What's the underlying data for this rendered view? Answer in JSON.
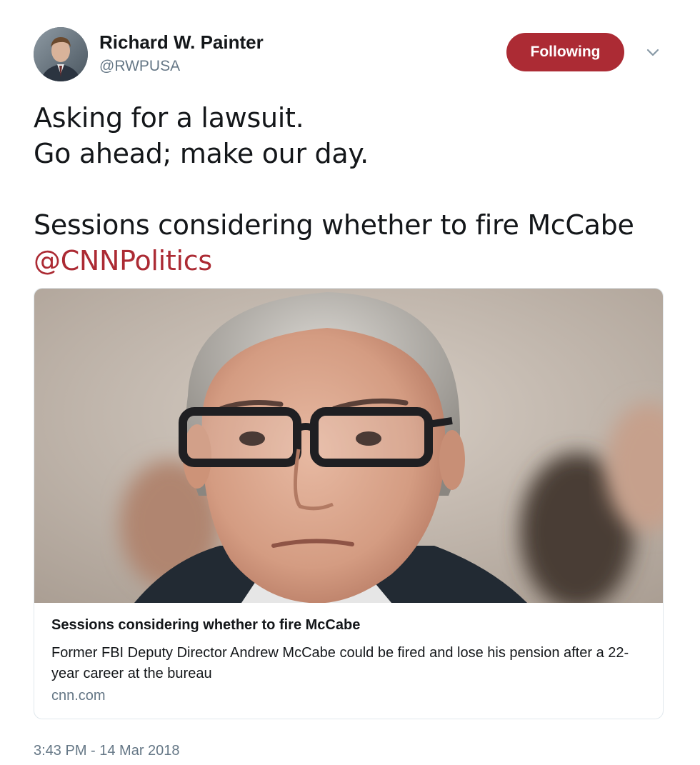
{
  "author": {
    "display_name": "Richard W. Painter",
    "handle": "@RWPUSA",
    "avatar_icon": "profile-photo"
  },
  "follow_button": {
    "label": "Following",
    "color": "#ac2b34"
  },
  "menu_icon": "chevron-down-icon",
  "tweet": {
    "line1": "Asking for a lawsuit.",
    "line2": "Go ahead; make our day.",
    "line3": "Sessions considering whether to fire McCabe",
    "mention": "@CNNPolitics",
    "mention_color": "#ac2b34"
  },
  "card": {
    "image_icon": "news-photo",
    "title": "Sessions considering whether to fire McCabe",
    "description": "Former FBI Deputy Director Andrew McCabe could be fired and lose his pension after a 22-year career at the bureau",
    "domain": "cnn.com"
  },
  "timestamp": "3:43 PM - 14 Mar 2018"
}
